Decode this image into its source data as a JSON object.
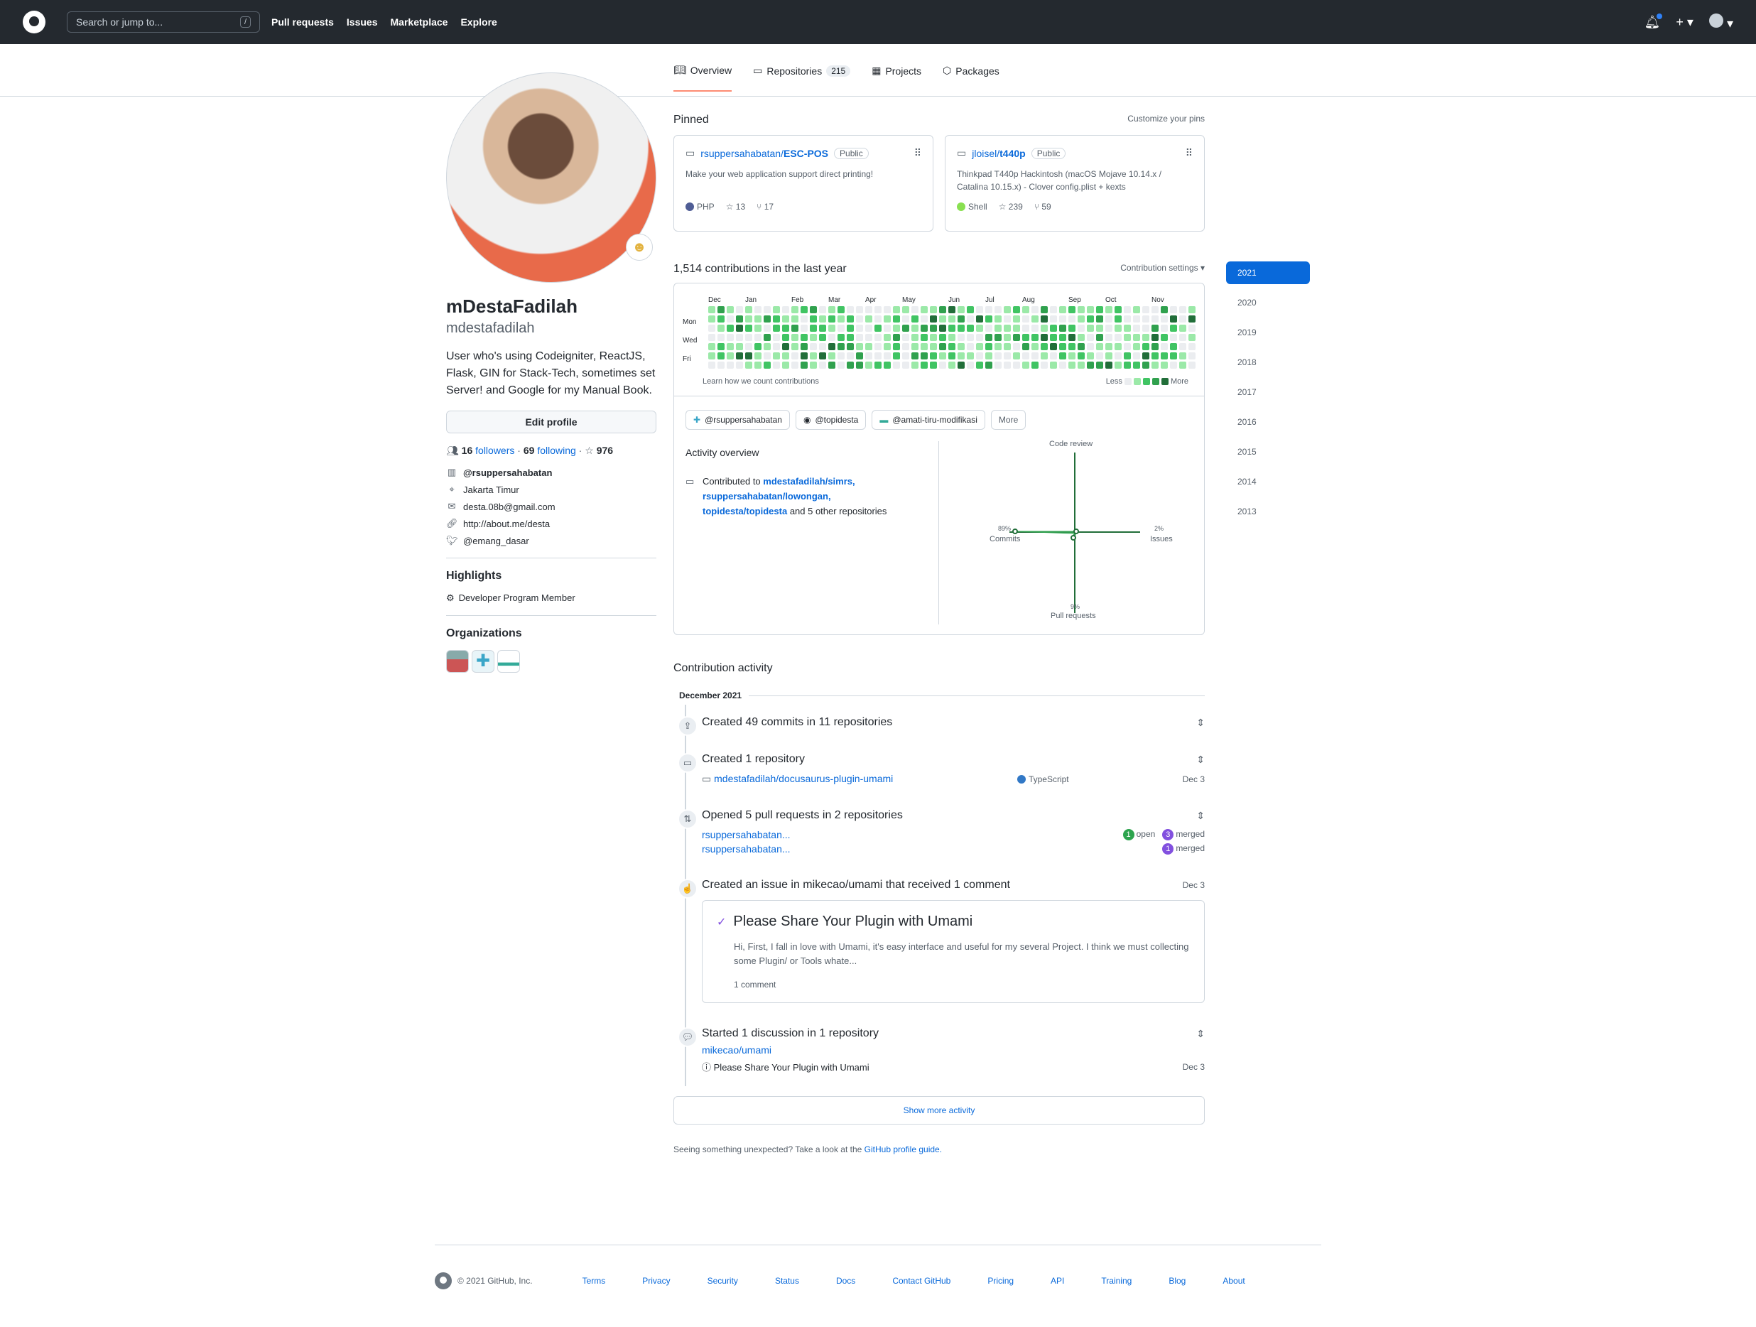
{
  "topbar": {
    "search_placeholder": "Search or jump to...",
    "search_key": "/",
    "nav": [
      "Pull requests",
      "Issues",
      "Marketplace",
      "Explore"
    ]
  },
  "tabs": [
    {
      "label": "Overview",
      "icon": "book-icon"
    },
    {
      "label": "Repositories",
      "icon": "repo-icon",
      "count": "215"
    },
    {
      "label": "Projects",
      "icon": "table-icon"
    },
    {
      "label": "Packages",
      "icon": "package-icon"
    }
  ],
  "profile": {
    "full_name": "mDestaFadilah",
    "login": "mdestafadilah",
    "bio": "User who's using Codeigniter, ReactJS, Flask, GIN for Stack-Tech, sometimes set Server! and Google for my Manual Book.",
    "edit_label": "Edit profile",
    "followers": "16",
    "followers_label": "followers",
    "following": "69",
    "following_label": "following",
    "stars": "976",
    "org": "@rsuppersahabatan",
    "location": "Jakarta Timur",
    "email": "desta.08b@gmail.com",
    "website": "http://about.me/desta",
    "twitter": "@emang_dasar",
    "highlights_title": "Highlights",
    "highlight": "Developer Program Member",
    "organizations_title": "Organizations"
  },
  "pinned": {
    "title": "Pinned",
    "customize": "Customize your pins",
    "items": [
      {
        "owner": "rsuppersahabatan/",
        "name": "ESC-POS",
        "badge": "Public",
        "desc": "Make your web application support direct printing!",
        "lang": "PHP",
        "lang_color": "#4F5D95",
        "stars": "13",
        "forks": "17"
      },
      {
        "owner": "jloisel/",
        "name": "t440p",
        "badge": "Public",
        "desc": "Thinkpad T440p Hackintosh (macOS Mojave 10.14.x / Catalina 10.15.x) - Clover config.plist + kexts",
        "lang": "Shell",
        "lang_color": "#89e051",
        "stars": "239",
        "forks": "59"
      }
    ]
  },
  "contrib": {
    "title": "1,514 contributions in the last year",
    "settings": "Contribution settings ▾",
    "months": [
      "Dec",
      "Jan",
      "Feb",
      "Mar",
      "Apr",
      "May",
      "Jun",
      "Jul",
      "Aug",
      "Sep",
      "Oct",
      "Nov"
    ],
    "days": [
      "Mon",
      "Wed",
      "Fri"
    ],
    "learn": "Learn how we count contributions",
    "less": "Less",
    "more": "More",
    "levels": [
      "#ebedf0",
      "#9be9a8",
      "#40c463",
      "#30a14e",
      "#216e39"
    ]
  },
  "filters": [
    "@rsuppersahabatan",
    "@topidesta",
    "@amati-tiru-modifikasi",
    "More"
  ],
  "activity_overview": {
    "title": "Activity overview",
    "contributed_to": "Contributed to",
    "repo1": "mdestafadilah/simrs,",
    "repo2": "rsuppersahabatan/lowongan,",
    "repo3": "topidesta/topidesta",
    "others": "and 5 other repositories",
    "code_review": "Code review",
    "commits_pct": "89%",
    "commits": "Commits",
    "issues_pct": "2%",
    "issues": "Issues",
    "pr_pct": "9%",
    "pr": "Pull requests"
  },
  "activity": {
    "title": "Contribution activity",
    "month": "December 2021",
    "commits": "Created 49 commits in 11 repositories",
    "created_repo": "Created 1 repository",
    "repo_name": "mdestafadilah/docusaurus-plugin-umami",
    "repo_lang": "TypeScript",
    "repo_date": "Dec 3",
    "prs": "Opened 5 pull requests in 2 repositories",
    "pr_repo1": "rsuppersahabatan...",
    "pr_repo2": "rsuppersahabatan...",
    "pr1_open": "1",
    "pr1_open_label": "open",
    "pr1_merged": "3",
    "pr1_merged_label": "merged",
    "pr2_merged": "1",
    "pr2_merged_label": "merged",
    "issue_head": "Created an issue in mikecao/umami that received 1 comment",
    "issue_date": "Dec 3",
    "issue_title": "Please Share Your Plugin with Umami",
    "issue_body": "Hi, First, I fall in love with Umami, it's easy interface and useful for my several Project. I think we must collecting some Plugin/ or Tools whate...",
    "issue_comments": "1 comment",
    "discussion_head": "Started 1 discussion in 1 repository",
    "discussion_repo": "mikecao/umami",
    "discussion_title": "Please Share Your Plugin with Umami",
    "discussion_date": "Dec 3",
    "show_more": "Show more activity",
    "unexpected": "Seeing something unexpected? Take a look at the",
    "guide": "GitHub profile guide."
  },
  "years": [
    "2021",
    "2020",
    "2019",
    "2018",
    "2017",
    "2016",
    "2015",
    "2014",
    "2013"
  ],
  "footer": {
    "copyright": "© 2021 GitHub, Inc.",
    "links": [
      "Terms",
      "Privacy",
      "Security",
      "Status",
      "Docs",
      "Contact GitHub",
      "Pricing",
      "API",
      "Training",
      "Blog",
      "About"
    ]
  }
}
